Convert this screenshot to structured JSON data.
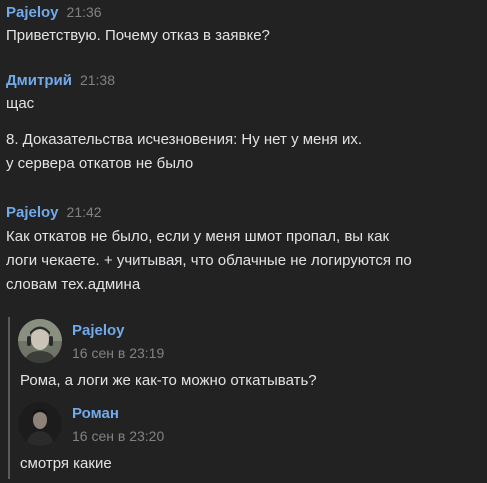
{
  "messages": [
    {
      "author": "Pajeloy",
      "time": "21:36",
      "lines": [
        "Приветствую. Почему отказ в заявке?"
      ]
    },
    {
      "author": "Дмитрий",
      "time": "21:38",
      "lines": [
        "щас",
        "",
        "8. Доказательства исчезновения: Ну нет у меня их.",
        "у сервера откатов не было"
      ]
    },
    {
      "author": "Pajeloy",
      "time": "21:42",
      "lines": [
        "Как откатов не было, если у меня шмот пропал, вы как",
        "логи чекаете. + учитывая, что облачные не логируются по",
        "словам тех.админа"
      ]
    }
  ],
  "forwarded": [
    {
      "author": "Pajeloy",
      "date": "16 сен в 23:19",
      "text": "Рома, а логи же как-то можно откатывать?",
      "avatar_icon": "user-avatar-pajeloy"
    },
    {
      "author": "Роман",
      "date": "16 сен в 23:20",
      "text": "смотря какие",
      "avatar_icon": "user-avatar-roman"
    }
  ],
  "colors": {
    "background": "#222222",
    "author_link": "#71aaeb",
    "text": "#e1e3e6",
    "meta": "#828282",
    "quote_bar": "#5b5b5b"
  }
}
